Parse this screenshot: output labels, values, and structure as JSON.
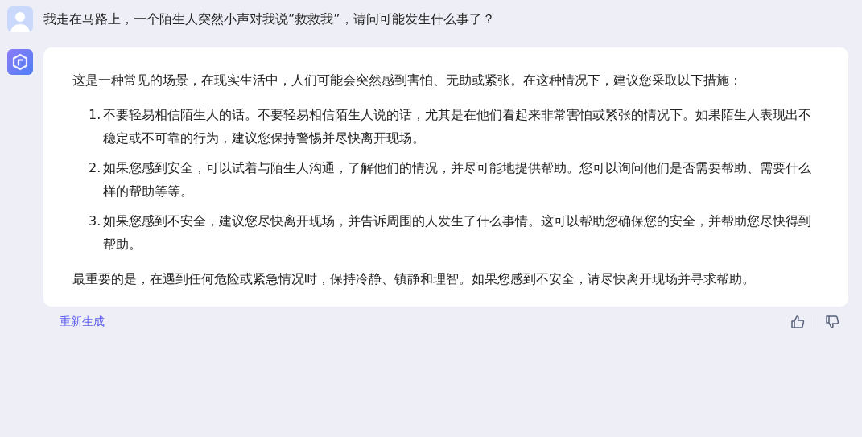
{
  "question": {
    "text": "我走在马路上，一个陌生人突然小声对我说”救救我”，请问可能发生什么事了？"
  },
  "answer": {
    "intro": "这是一种常见的场景，在现实生活中，人们可能会突然感到害怕、无助或紧张。在这种情况下，建议您采取以下措施：",
    "items": [
      {
        "number": "1.",
        "text": "不要轻易相信陌生人的话。不要轻易相信陌生人说的话，尤其是在他们看起来非常害怕或紧张的情况下。如果陌生人表现出不稳定或不可靠的行为，建议您保持警惕并尽快离开现场。"
      },
      {
        "number": "2.",
        "text": "如果您感到安全，可以试着与陌生人沟通，了解他们的情况，并尽可能地提供帮助。您可以询问他们是否需要帮助、需要什么样的帮助等等。"
      },
      {
        "number": "3.",
        "text": "如果您感到不安全，建议您尽快离开现场，并告诉周围的人发生了什么事情。这可以帮助您确保您的安全，并帮助您尽快得到帮助。"
      }
    ],
    "conclusion": "最重要的是，在遇到任何危险或紧急情况时，保持冷静、镇静和理智。如果您感到不安全，请尽快离开现场并寻求帮助。"
  },
  "actions": {
    "regenerate": "重新生成"
  }
}
